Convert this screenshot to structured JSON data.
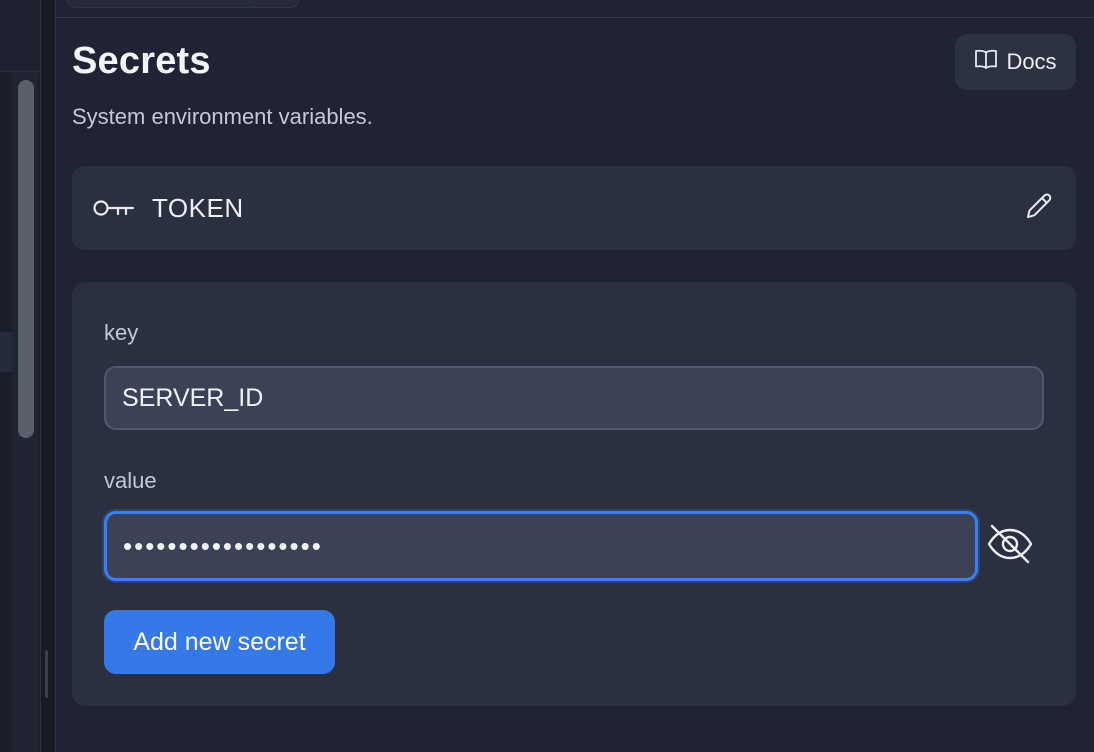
{
  "panel": {
    "title": "Secrets",
    "subtitle": "System environment variables.",
    "docs_label": "Docs"
  },
  "secrets": {
    "items": [
      {
        "name": "TOKEN",
        "icon": "key-icon"
      }
    ]
  },
  "form": {
    "key_label": "key",
    "key_value": "SERVER_ID",
    "value_label": "value",
    "value_masked": "••••••••••••••••••",
    "add_label": "Add new secret"
  },
  "colors": {
    "background": "#1f2333",
    "card": "#2b3041",
    "accent": "#3578e8",
    "focus_ring": "#3a7ef0"
  }
}
